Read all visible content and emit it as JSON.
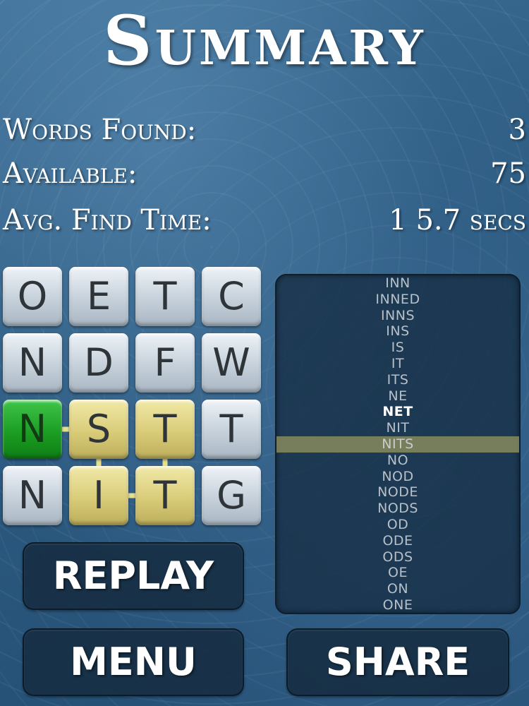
{
  "title": "Summary",
  "stats": {
    "words_found_label": "Words Found:",
    "words_found_value": "3",
    "available_label": "Available:",
    "available_value": "75",
    "avg_time_label": "Avg. Find Time:",
    "avg_time_value": "1 5.7 secs"
  },
  "grid": {
    "rows": [
      [
        "O",
        "E",
        "T",
        "C"
      ],
      [
        "N",
        "D",
        "F",
        "W"
      ],
      [
        "N",
        "S",
        "T",
        "T"
      ],
      [
        "N",
        "I",
        "T",
        "G"
      ]
    ],
    "path": [
      [
        2,
        0
      ],
      [
        2,
        1
      ],
      [
        3,
        1
      ],
      [
        3,
        2
      ],
      [
        2,
        2
      ]
    ],
    "colors": {
      "start": "#1b9e23",
      "selected": "#d9cc79",
      "normal": "#c5d0da"
    }
  },
  "word_list": {
    "words": [
      "INN",
      "INNED",
      "INNS",
      "INS",
      "IS",
      "IT",
      "ITS",
      "NE",
      "NET",
      "NIT",
      "NITS",
      "NO",
      "NOD",
      "NODE",
      "NODS",
      "OD",
      "ODE",
      "ODS",
      "OE",
      "ON",
      "ONE"
    ],
    "found": [
      "NET"
    ],
    "highlighted": "NITS"
  },
  "buttons": {
    "replay": "REPLAY",
    "menu": "MENU",
    "share": "SHARE"
  }
}
